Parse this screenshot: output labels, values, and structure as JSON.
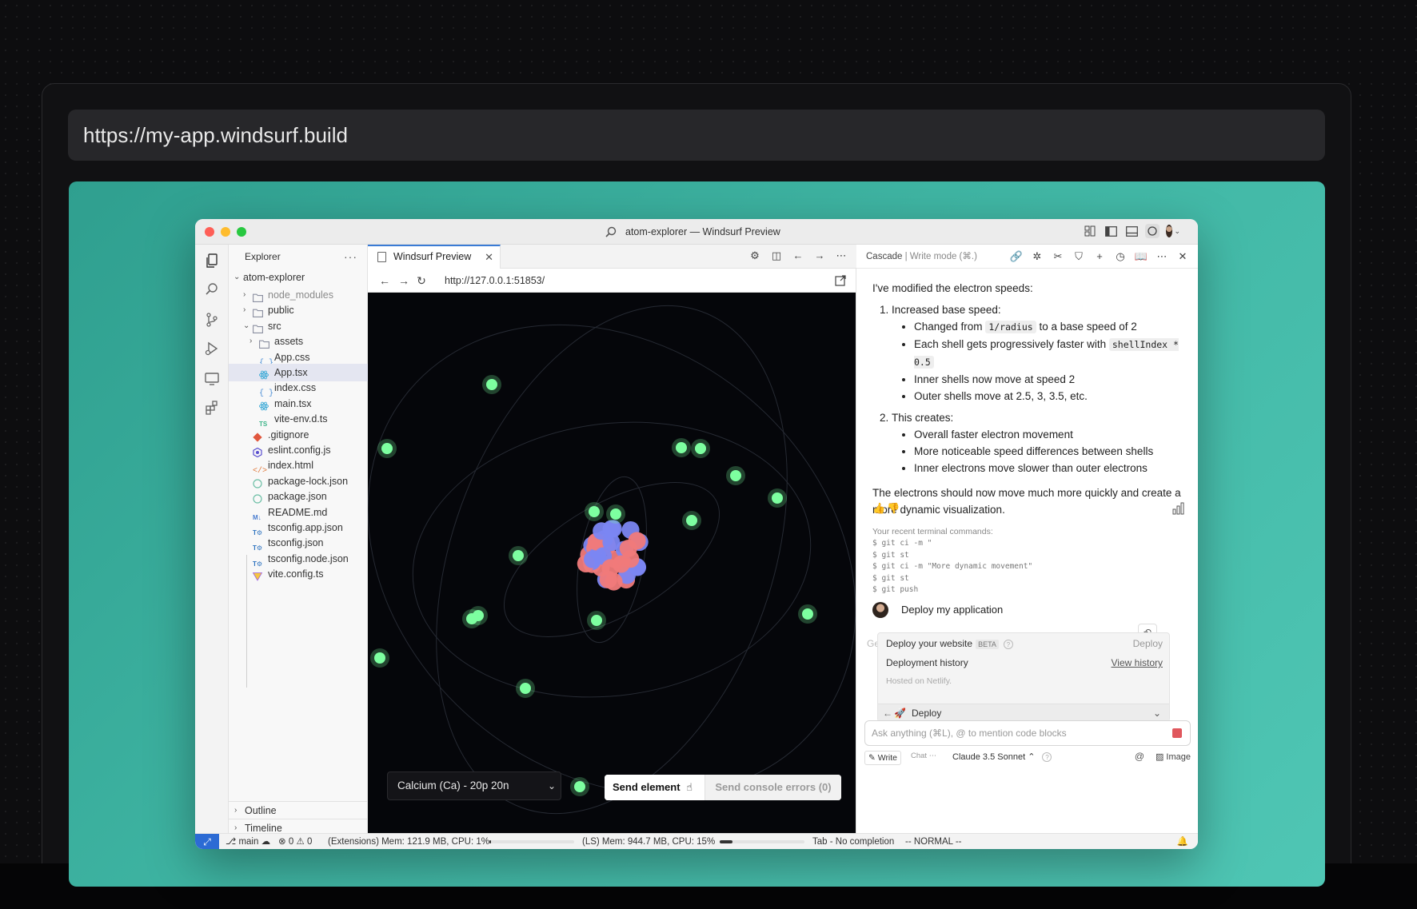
{
  "page": {
    "url": "https://my-app.windsurf.build"
  },
  "window": {
    "title": "atom-explorer — Windsurf Preview"
  },
  "sidebar": {
    "header": "Explorer",
    "more": "···",
    "project": "atom-explorer",
    "items": [
      {
        "label": "node_modules",
        "type": "folder",
        "collapsed": true,
        "depth": 1
      },
      {
        "label": "public",
        "type": "folder",
        "collapsed": true,
        "depth": 1
      },
      {
        "label": "src",
        "type": "folder",
        "collapsed": false,
        "depth": 1
      },
      {
        "label": "assets",
        "type": "folder",
        "collapsed": true,
        "depth": 2
      },
      {
        "label": "App.css",
        "type": "css",
        "depth": 2
      },
      {
        "label": "App.tsx",
        "type": "react",
        "depth": 2,
        "selected": true
      },
      {
        "label": "index.css",
        "type": "css",
        "depth": 2
      },
      {
        "label": "main.tsx",
        "type": "react",
        "depth": 2
      },
      {
        "label": "vite-env.d.ts",
        "type": "ts",
        "depth": 2
      },
      {
        "label": ".gitignore",
        "type": "git",
        "depth": 1
      },
      {
        "label": "eslint.config.js",
        "type": "eslint",
        "depth": 1
      },
      {
        "label": "index.html",
        "type": "html",
        "depth": 1
      },
      {
        "label": "package-lock.json",
        "type": "npm",
        "depth": 1
      },
      {
        "label": "package.json",
        "type": "npm",
        "depth": 1
      },
      {
        "label": "README.md",
        "type": "md",
        "depth": 1
      },
      {
        "label": "tsconfig.app.json",
        "type": "tsconfig",
        "depth": 1
      },
      {
        "label": "tsconfig.json",
        "type": "tsconfig",
        "depth": 1
      },
      {
        "label": "tsconfig.node.json",
        "type": "tsconfig",
        "depth": 1
      },
      {
        "label": "vite.config.ts",
        "type": "vite",
        "depth": 1
      }
    ],
    "outline": "Outline",
    "timeline": "Timeline"
  },
  "editor": {
    "tab_label": "Windsurf Preview",
    "preview_url": "http://127.0.0.1:51853/",
    "element_select": "Calcium (Ca) - 20p 20n",
    "send_element": "Send element",
    "send_console_errors": "Send console errors (0)"
  },
  "cascade": {
    "title": "Cascade",
    "mode": "| Write mode (⌘.)",
    "intro": "I've modified the electron speeds:",
    "section1_title": "Increased base speed:",
    "s1_b1_pre": "Changed from ",
    "s1_b1_code": "1/radius",
    "s1_b1_post": " to a base speed of 2",
    "s1_b2_pre": "Each shell gets progressively faster with ",
    "s1_b2_code": "shellIndex * 0.5",
    "s1_b3": "Inner shells now move at speed 2",
    "s1_b4": "Outer shells move at 2.5, 3, 3.5, etc.",
    "section2_title": "This creates:",
    "s2_b1": "Overall faster electron movement",
    "s2_b2": "More noticeable speed differences between shells",
    "s2_b3": "Inner electrons move slower than outer electrons",
    "conclusion": "The electrons should now move much more quickly and create a more dynamic visualization.",
    "terminal_title": "Your recent terminal commands:",
    "terminal_commands": [
      "$ git ci -m \"",
      "$ git st",
      "$ git ci -m \"More dynamic movement\"",
      "$ git st",
      "$ git push"
    ],
    "user_message": "Deploy my application",
    "ge_fragment": "Ge",
    "deploy_title": "Deploy your website",
    "deploy_badge": "BETA",
    "deploy_button": "Deploy",
    "history_label": "Deployment history",
    "history_link": "View history",
    "hosted": "Hosted on Netlify.",
    "deploy_action": "Deploy",
    "input_placeholder": "Ask anything (⌘L), @ to mention code blocks",
    "mode_write": "Write",
    "mode_chat": "Chat",
    "model": "Claude 3.5 Sonnet",
    "image_label": "Image"
  },
  "statusbar": {
    "branch": "main",
    "errors": "0",
    "warnings": "0",
    "extensions": "(Extensions) Mem: 121.9 MB, CPU: 1%",
    "ls": "(LS) Mem: 944.7 MB, CPU: 15%",
    "completion": "Tab - No completion",
    "vim_mode": "-- NORMAL --",
    "extensions_meter": 0.02,
    "ls_meter": 0.15
  },
  "colors": {
    "accent": "#3a7bd5",
    "stage": "#3fb5a3",
    "electron": "#7dffa0",
    "proton": "#f07a7a",
    "neutron": "#7b86f2"
  }
}
